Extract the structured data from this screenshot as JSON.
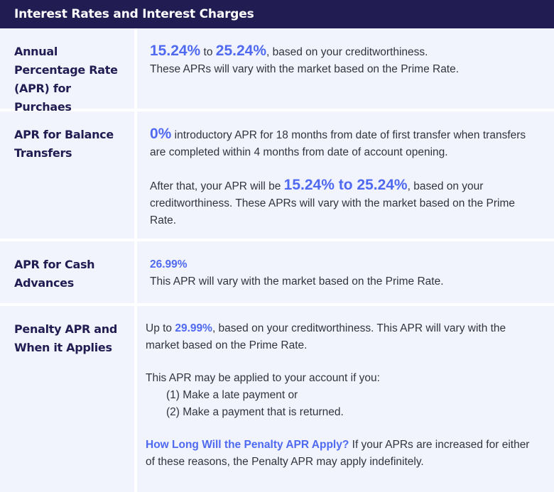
{
  "header": {
    "title": "Interest Rates and Interest Charges"
  },
  "colors": {
    "header_bg": "#211C52",
    "cell_bg": "#F1F3FD",
    "accent": "#4F6AF0",
    "label_text": "#211C52"
  },
  "rows": [
    {
      "label": "Annual Percentage Rate (APR) for Purchaes",
      "rate_low": "15.24%",
      "to_text": " to ",
      "rate_high": "25.24%",
      "line1_suffix": ", based on your creditworthiness.",
      "line2": "These APRs will vary with the market based on the Prime Rate."
    },
    {
      "label": "APR for Balance Transfers",
      "intro_rate": "0%",
      "intro_text": " introductory APR for 18 months from date of first transfer when transfers are completed within 4 months from date of account opening.",
      "after_prefix": "After that, your APR will be ",
      "after_rate": "15.24% to 25.24%",
      "after_suffix": ", based on your creditworthiness. These APRs will vary with the market based on the Prime Rate."
    },
    {
      "label": "APR for Cash Advances",
      "rate": "26.99%",
      "text": "This APR will vary with the market based on the Prime Rate."
    },
    {
      "label": "Penalty APR and When it Applies",
      "p1_prefix": "Up to ",
      "p1_rate": "29.99%",
      "p1_suffix": ", based on your creditworthiness. This APR will vary with the market based on the Prime Rate.",
      "p2_intro": "This APR may be applied to your account if you:",
      "p2_items": [
        "(1) Make a late payment or",
        "(2) Make a payment that is returned."
      ],
      "p3_heading": "How Long Will the Penalty APR Apply?",
      "p3_text": " If your APRs are increased for either of these reasons, the Penalty APR may apply indefinitely."
    }
  ]
}
